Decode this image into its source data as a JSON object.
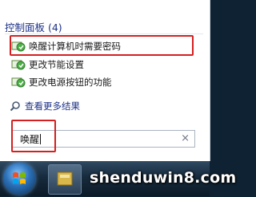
{
  "results": {
    "group_header": "控制面板 (4)",
    "items": [
      {
        "label": "唤醒计算机时需要密码",
        "icon": "control-panel-icon"
      },
      {
        "label": "更改节能设置",
        "icon": "control-panel-icon"
      },
      {
        "label": "更改电源按钮的功能",
        "icon": "control-panel-icon"
      }
    ],
    "see_more": "查看更多结果"
  },
  "search": {
    "value": "唤醒",
    "clear": "×"
  },
  "taskbar": {
    "watermark": "shenduwin8.com"
  }
}
